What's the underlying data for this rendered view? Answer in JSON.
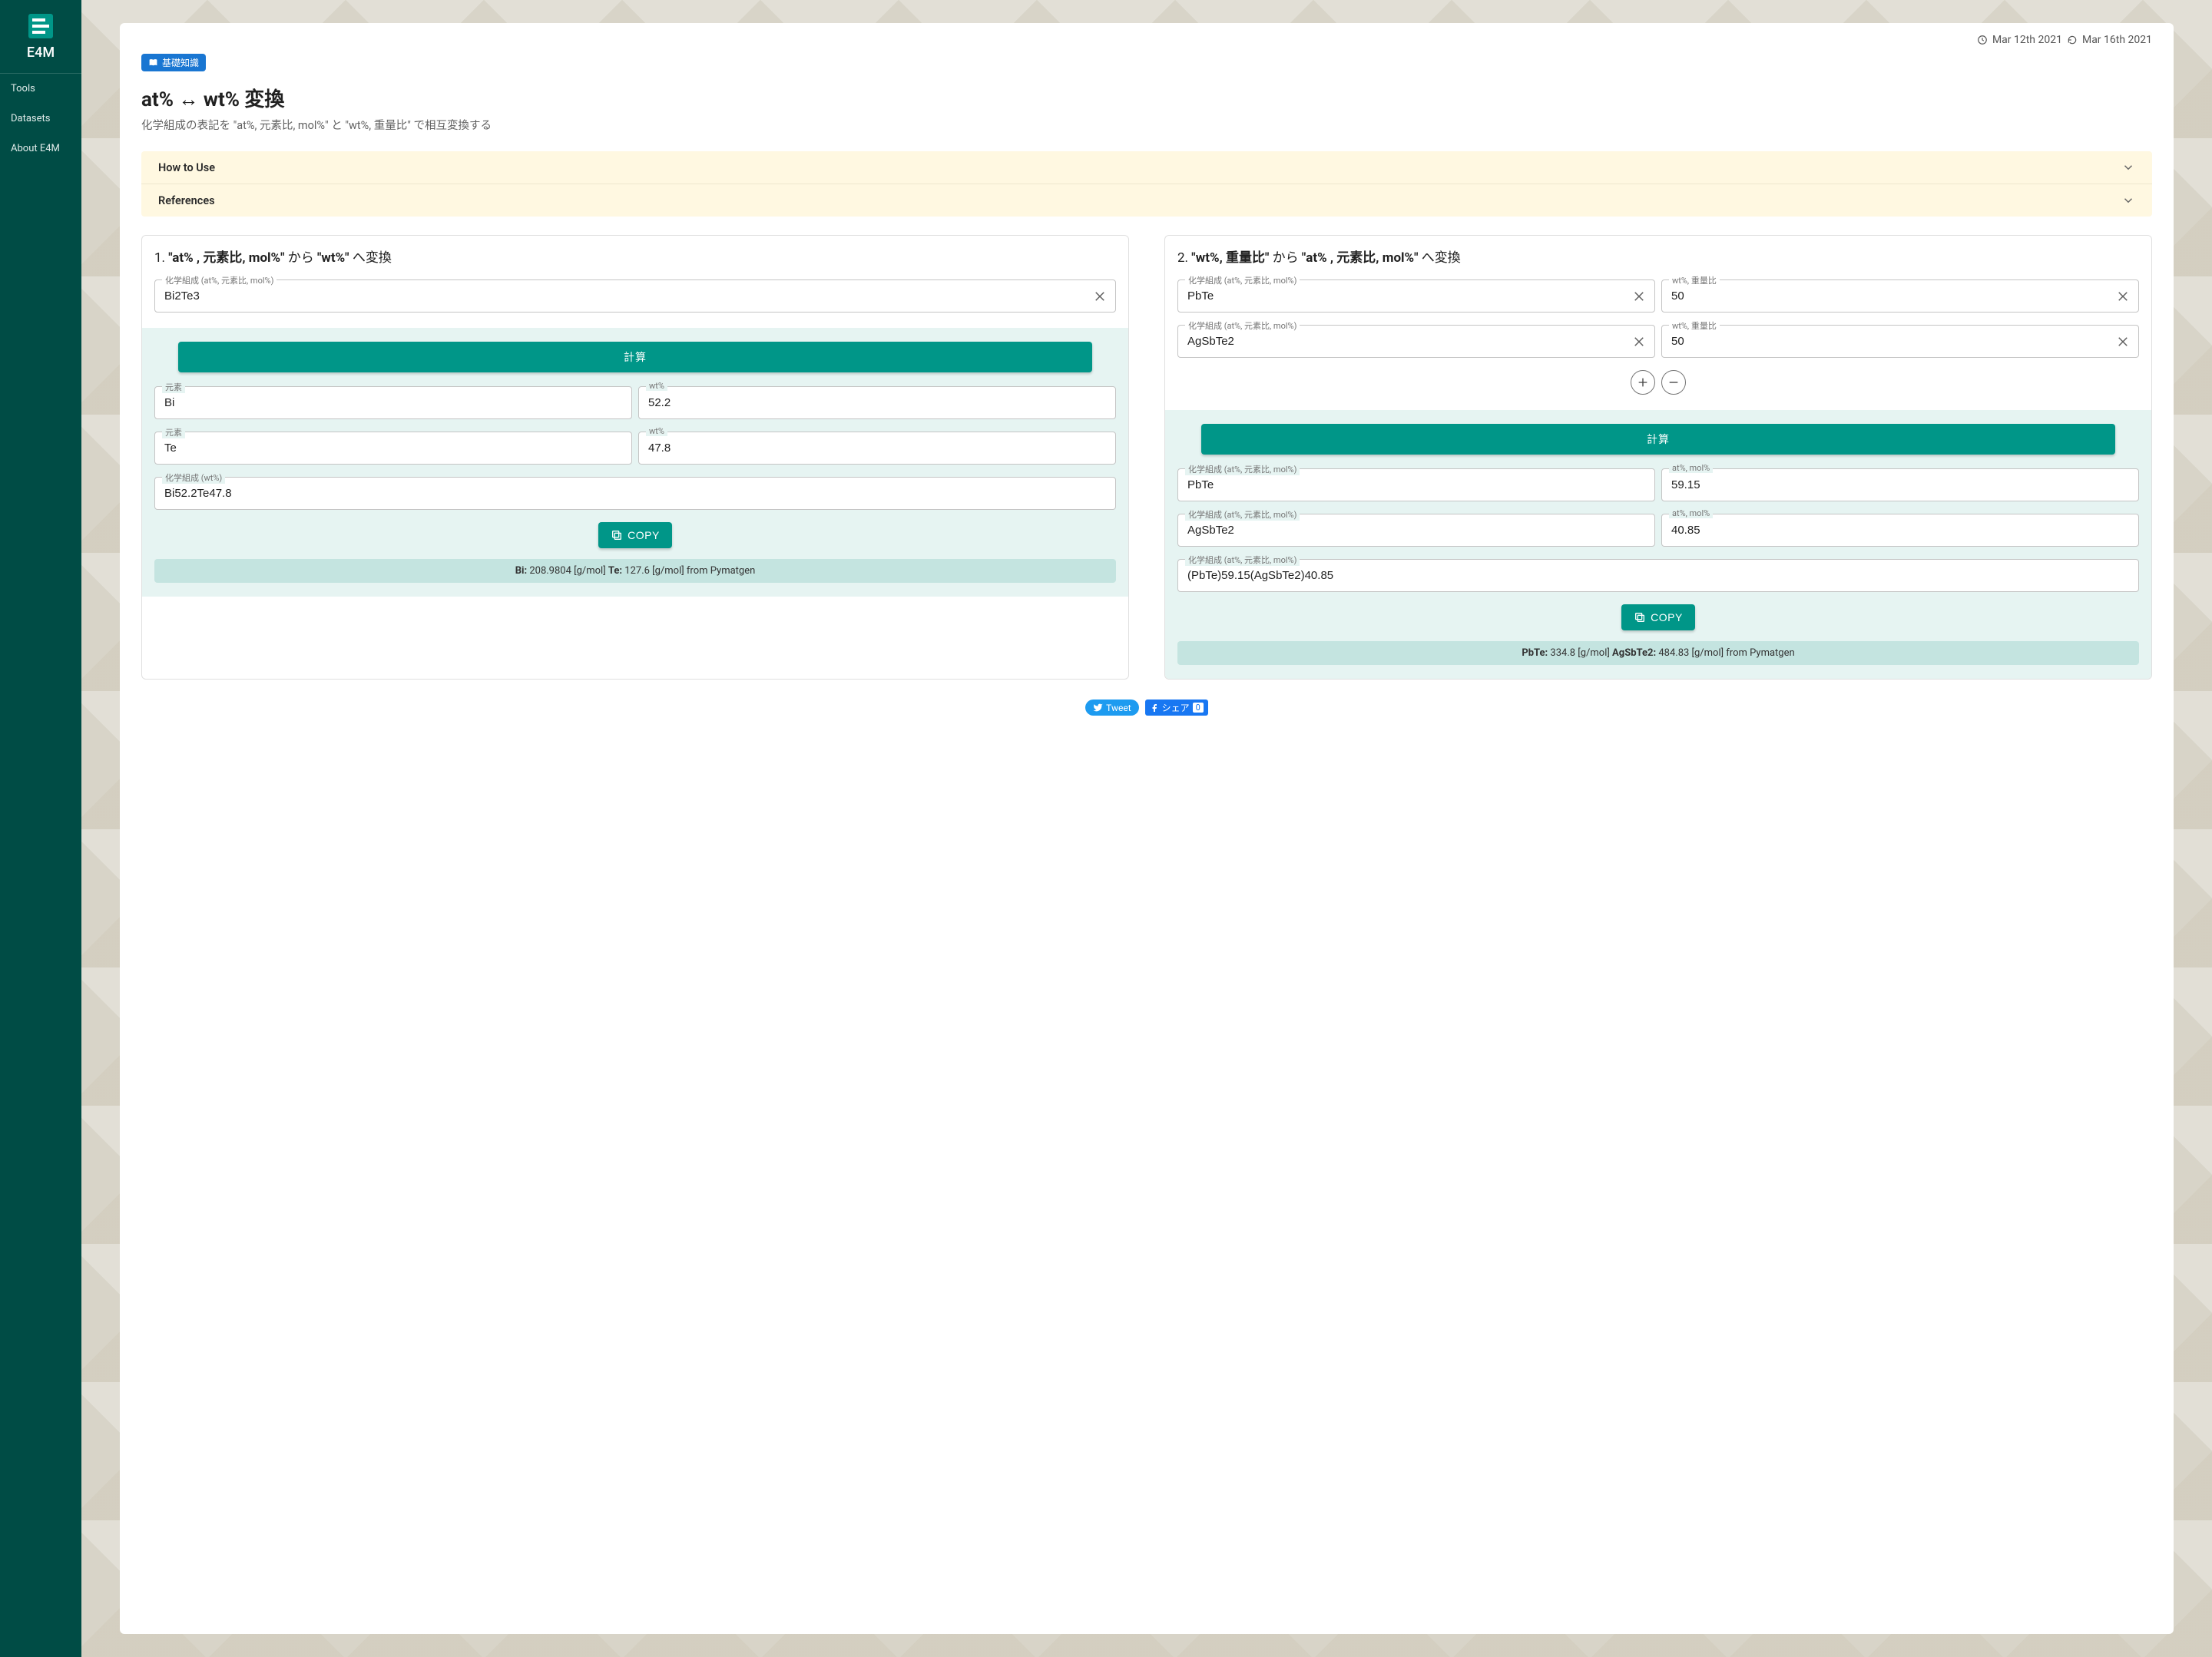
{
  "brand": "E4M",
  "sidebar": {
    "items": [
      "Tools",
      "Datasets",
      "About E4M"
    ]
  },
  "dates": {
    "created": "Mar 12th 2021",
    "updated": "Mar 16th 2021"
  },
  "chip": "基礎知識",
  "title": "at% ↔ wt% 変換",
  "subtitle": "化学組成の表記を \"at%, 元素比, mol%\" と \"wt%, 重量比\" で相互変換する",
  "accordion": {
    "howto": "How to Use",
    "refs": "References"
  },
  "labels": {
    "comp_at": "化学組成 (at%, 元素比, mol%)",
    "comp_wt": "化学組成 (wt%)",
    "element": "元素",
    "wt": "wt%",
    "wt_ratio": "wt%, 重量比",
    "at_mol": "at%, mol%",
    "calc": "計算",
    "copy": "COPY"
  },
  "panel1": {
    "title_prefix": "1. ",
    "title_b1": "\"at% , 元素比, mol%\"",
    "title_mid": " から ",
    "title_b2": "\"wt%\"",
    "title_suffix": " へ変換",
    "input": "Bi2Te3",
    "results": [
      {
        "el": "Bi",
        "wt": "52.2"
      },
      {
        "el": "Te",
        "wt": "47.8"
      }
    ],
    "comp_wt": "Bi52.2Te47.8",
    "info_b1": "Bi:",
    "info_v1": " 208.9804 [g/mol]  ",
    "info_b2": "Te:",
    "info_v2": " 127.6 [g/mol]   from Pymatgen"
  },
  "panel2": {
    "title_prefix": "2. ",
    "title_b1": "\"wt%, 重量比\"",
    "title_mid": " から ",
    "title_b2": "\"at% , 元素比, mol%\"",
    "title_suffix": " へ変換",
    "inputs": [
      {
        "comp": "PbTe",
        "wt": "50"
      },
      {
        "comp": "AgSbTe2",
        "wt": "50"
      }
    ],
    "results": [
      {
        "comp": "PbTe",
        "at": "59.15"
      },
      {
        "comp": "AgSbTe2",
        "at": "40.85"
      }
    ],
    "comp_at": "(PbTe)59.15(AgSbTe2)40.85",
    "info_b1": "PbTe:",
    "info_v1": " 334.8 [g/mol]  ",
    "info_b2": "AgSbTe2:",
    "info_v2": " 484.83 [g/mol]   from Pymatgen"
  },
  "social": {
    "tweet": "Tweet",
    "share": "シェア",
    "count": "0"
  }
}
